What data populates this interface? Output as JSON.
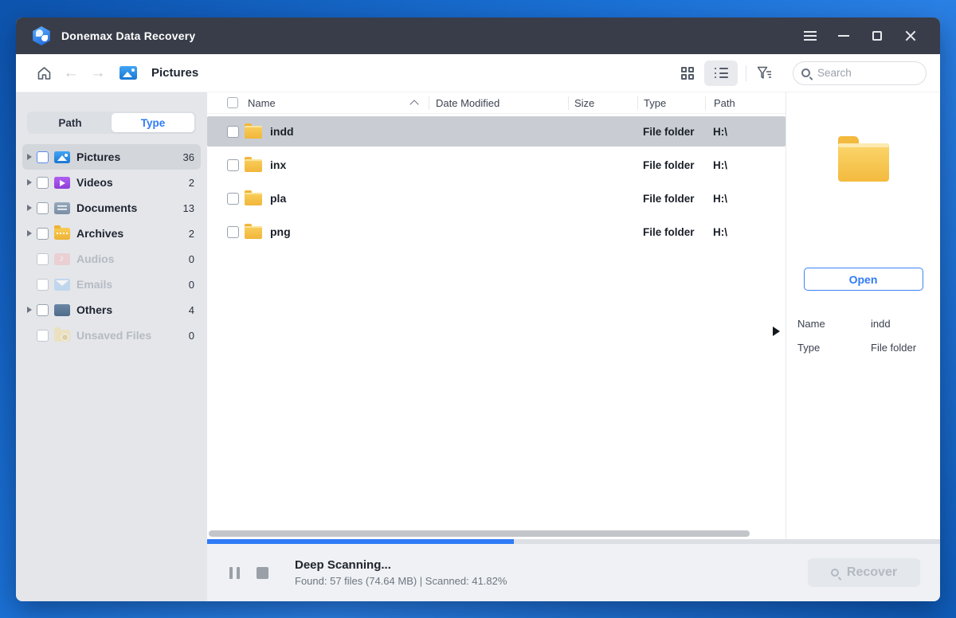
{
  "window": {
    "title": "Donemax Data Recovery"
  },
  "toolbar": {
    "breadcrumb": "Pictures",
    "search_placeholder": "Search"
  },
  "sidebar": {
    "tabs": [
      {
        "label": "Path",
        "active": false
      },
      {
        "label": "Type",
        "active": true
      }
    ],
    "items": [
      {
        "label": "Pictures",
        "count": "36",
        "icon": "pictures-folder-icon",
        "enabled": true,
        "selected": true,
        "expandable": true
      },
      {
        "label": "Videos",
        "count": "2",
        "icon": "videos-folder-icon",
        "enabled": true,
        "selected": false,
        "expandable": true
      },
      {
        "label": "Documents",
        "count": "13",
        "icon": "documents-folder-icon",
        "enabled": true,
        "selected": false,
        "expandable": true
      },
      {
        "label": "Archives",
        "count": "2",
        "icon": "archives-folder-icon",
        "enabled": true,
        "selected": false,
        "expandable": true
      },
      {
        "label": "Audios",
        "count": "0",
        "icon": "audios-folder-icon",
        "enabled": false,
        "selected": false,
        "expandable": false
      },
      {
        "label": "Emails",
        "count": "0",
        "icon": "emails-folder-icon",
        "enabled": false,
        "selected": false,
        "expandable": false
      },
      {
        "label": "Others",
        "count": "4",
        "icon": "others-folder-icon",
        "enabled": true,
        "selected": false,
        "expandable": true
      },
      {
        "label": "Unsaved Files",
        "count": "0",
        "icon": "unsaved-folder-icon",
        "enabled": false,
        "selected": false,
        "expandable": false
      }
    ]
  },
  "file_list": {
    "columns": [
      "Name",
      "Date Modified",
      "Size",
      "Type",
      "Path"
    ],
    "rows": [
      {
        "name": "indd",
        "date_modified": "",
        "size": "",
        "type": "File folder",
        "path": "H:\\",
        "selected": true
      },
      {
        "name": "inx",
        "date_modified": "",
        "size": "",
        "type": "File folder",
        "path": "H:\\",
        "selected": false
      },
      {
        "name": "pla",
        "date_modified": "",
        "size": "",
        "type": "File folder",
        "path": "H:\\",
        "selected": false
      },
      {
        "name": "png",
        "date_modified": "",
        "size": "",
        "type": "File folder",
        "path": "H:\\",
        "selected": false
      }
    ]
  },
  "details_panel": {
    "open_label": "Open",
    "fields": [
      {
        "label": "Name",
        "value": "indd"
      },
      {
        "label": "Type",
        "value": "File folder"
      }
    ]
  },
  "status_bar": {
    "title": "Deep Scanning...",
    "info": "Found: 57 files (74.64 MB) | Scanned: 41.82%",
    "progress_percent": 41.82,
    "recover_label": "Recover"
  },
  "colors": {
    "accent_blue": "#2f7bf6",
    "titlebar_bg": "#383d49",
    "sidebar_bg": "#e4e6ea",
    "selected_row": "#c9cdd3",
    "folder_yellow": "#f3ba3e",
    "desktop_blue": "#1b72d6"
  }
}
